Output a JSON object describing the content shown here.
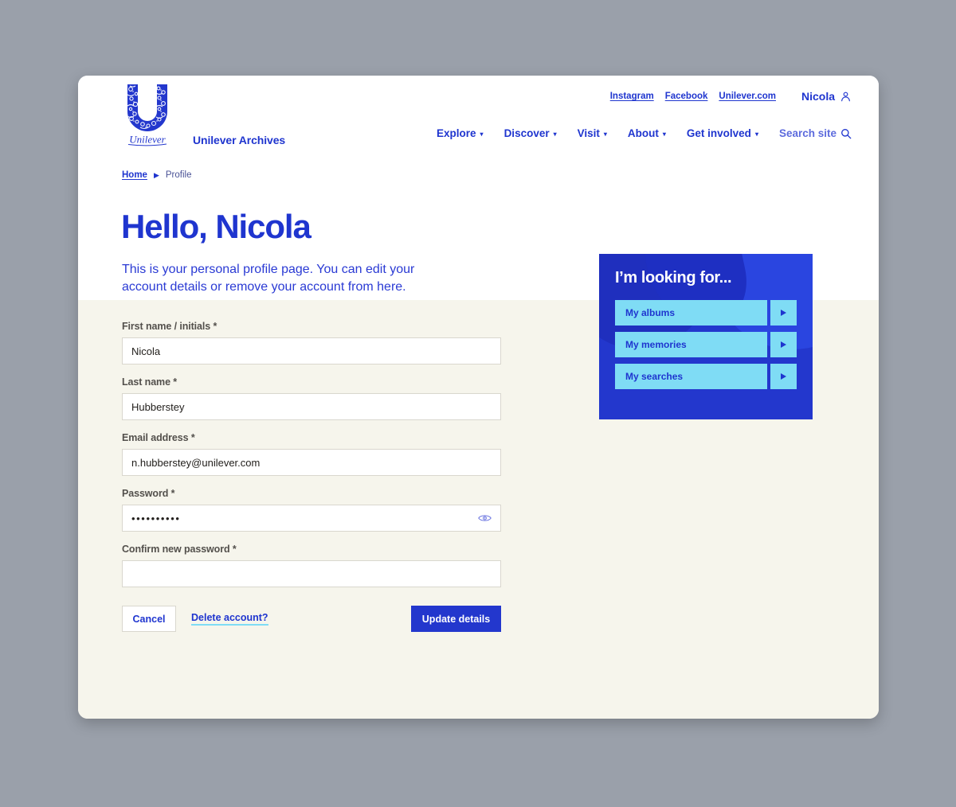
{
  "brand": {
    "logo_icon": "unilever-u-logo",
    "logo_wordmark": "Unilever",
    "site_name": "Unilever Archives"
  },
  "utility_nav": {
    "links": [
      {
        "label": "Instagram"
      },
      {
        "label": "Facebook"
      },
      {
        "label": "Unilever.com"
      }
    ],
    "user_name": "Nicola",
    "user_icon": "person-icon"
  },
  "main_nav": {
    "items": [
      {
        "label": "Explore",
        "caret": "▾"
      },
      {
        "label": "Discover",
        "caret": "▾"
      },
      {
        "label": "Visit",
        "caret": "▾"
      },
      {
        "label": "About",
        "caret": "▾"
      },
      {
        "label": "Get involved",
        "caret": "▾"
      }
    ],
    "search_label": "Search site",
    "search_icon": "search-icon"
  },
  "breadcrumb": {
    "home": "Home",
    "separator": "▶",
    "current": "Profile"
  },
  "hero": {
    "title": "Hello, Nicola",
    "intro": "This is your personal profile page. You can edit your account details or remove your account from here."
  },
  "looking_panel": {
    "title": "I’m looking for...",
    "items": [
      {
        "label": "My albums",
        "arrow_icon": "play-arrow-icon"
      },
      {
        "label": "My memories",
        "arrow_icon": "play-arrow-icon"
      },
      {
        "label": "My searches",
        "arrow_icon": "play-arrow-icon"
      }
    ]
  },
  "form": {
    "fields": [
      {
        "label": "First name / initials *",
        "value": "Nicola",
        "placeholder": ""
      },
      {
        "label": "Last name *",
        "value": "Hubberstey",
        "placeholder": ""
      },
      {
        "label": "Email address *",
        "value": "n.hubberstey@unilever.com",
        "placeholder": ""
      },
      {
        "label": "Password *",
        "value": "••••••••••",
        "placeholder": "",
        "reveal_icon": "eye-icon"
      },
      {
        "label": "Confirm new password *",
        "value": "",
        "placeholder": ""
      }
    ],
    "cancel_label": "Cancel",
    "delete_label": "Delete account?",
    "submit_label": "Update details"
  },
  "colors": {
    "brand_blue": "#1f35cf",
    "panel_blue": "#2337cd",
    "cyan": "#7fdcf5",
    "cream": "#f6f5ec",
    "page_bg": "#9aa0aa",
    "label_gray": "#53504c"
  }
}
